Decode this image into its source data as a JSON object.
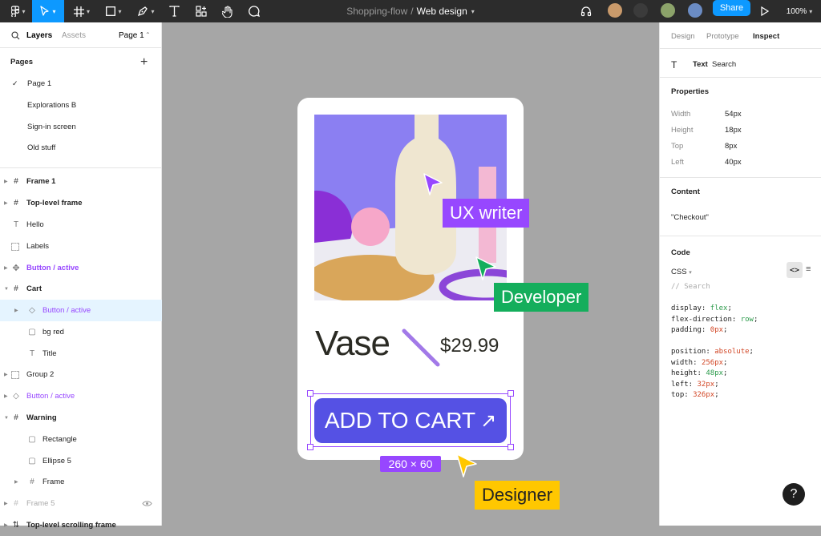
{
  "topbar": {
    "file_project": "Shopping-flow",
    "separator": "/",
    "file_name": "Web design",
    "share_label": "Share",
    "zoom": "100%"
  },
  "left_panel": {
    "tab_layers": "Layers",
    "tab_assets": "Assets",
    "page_selector": "Page 1",
    "pages_heading": "Pages",
    "pages": [
      "Page 1",
      "Explorations B",
      "Sign-in screen",
      "Old stuff"
    ],
    "layers": [
      {
        "label": "Frame 1",
        "icon": "frame-icon"
      },
      {
        "label": "Top-level frame",
        "icon": "frame-icon"
      },
      {
        "label": "Hello",
        "icon": "text-icon"
      },
      {
        "label": "Labels",
        "icon": "section-icon"
      },
      {
        "label": "Button / active",
        "icon": "component-icon"
      },
      {
        "label": "Cart",
        "icon": "frame-icon"
      },
      {
        "label": "Button / active",
        "icon": "instance-icon"
      },
      {
        "label": "bg red",
        "icon": "rectangle-icon"
      },
      {
        "label": "Title",
        "icon": "text-icon"
      },
      {
        "label": "Group 2",
        "icon": "group-icon"
      },
      {
        "label": "Button / active",
        "icon": "instance-icon"
      },
      {
        "label": "Warning",
        "icon": "frame-icon"
      },
      {
        "label": "Rectangle",
        "icon": "rectangle-icon"
      },
      {
        "label": "Ellipse 5",
        "icon": "rectangle-icon"
      },
      {
        "label": "Frame",
        "icon": "frame-icon"
      },
      {
        "label": "Frame 5",
        "icon": "frame-icon"
      },
      {
        "label": "Top-level scrolling frame",
        "icon": "scroll-frame-icon"
      }
    ]
  },
  "canvas": {
    "product_title": "Vase",
    "product_price": "$29.99",
    "cart_button": "ADD TO CART",
    "cart_arrow": "↗",
    "selection_size": "260 × 60",
    "cursor_ux": "UX writer",
    "cursor_dev": "Developer",
    "cursor_designer": "Designer"
  },
  "right_panel": {
    "tab_design": "Design",
    "tab_prototype": "Prototype",
    "tab_inspect": "Inspect",
    "layer_type": "Text",
    "layer_name": "Search",
    "properties_heading": "Properties",
    "props": [
      {
        "label": "Width",
        "value": "54px"
      },
      {
        "label": "Height",
        "value": "18px"
      },
      {
        "label": "Top",
        "value": "8px"
      },
      {
        "label": "Left",
        "value": "40px"
      }
    ],
    "content_heading": "Content",
    "content_value": "\"Checkout\"",
    "code_heading": "Code",
    "code_lang": "CSS",
    "code_comment": "// Search"
  },
  "colors": {
    "accent": "#0d99ff",
    "purple": "#9747ff",
    "button": "#5551e4",
    "developer": "#14ae5c",
    "designer": "#ffc700"
  }
}
